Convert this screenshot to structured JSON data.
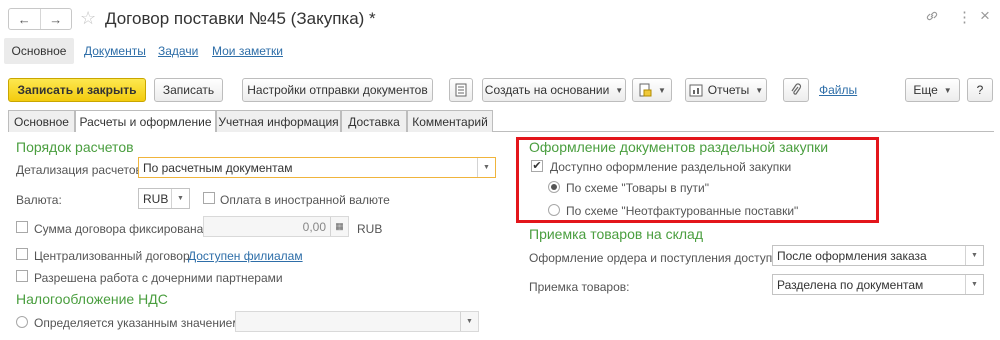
{
  "window": {
    "title": "Договор поставки №45 (Закупка) *",
    "nav_back": "←",
    "nav_forward": "→",
    "star": "☆",
    "link_icon": "🔗",
    "more_icon": "⋮",
    "close_icon": "×"
  },
  "sections": {
    "active": "Основное",
    "links": [
      "Документы",
      "Задачи",
      "Мои заметки"
    ]
  },
  "toolbar": {
    "save_close": "Записать и закрыть",
    "save": "Записать",
    "send_settings": "Настройки отправки документов",
    "create_based": "Создать на основании",
    "reports": "Отчеты",
    "files": "Файлы",
    "more": "Еще",
    "help": "?"
  },
  "tabs": [
    "Основное",
    "Расчеты и оформление",
    "Учетная информация",
    "Доставка",
    "Комментарий"
  ],
  "active_tab": "Расчеты и оформление",
  "left": {
    "settlement_header": "Порядок расчетов",
    "detail_label": "Детализация расчетов:",
    "detail_value": "По расчетным документам",
    "currency_label": "Валюта:",
    "currency_value": "RUB",
    "foreign_payment_label": "Оплата в иностранной валюте",
    "fixed_sum_label": "Сумма договора фиксирована",
    "fixed_sum_value": "0,00",
    "fixed_sum_currency": "RUB",
    "centralized_label": "Централизованный договор",
    "branches_link": "Доступен филиалам",
    "partners_label": "Разрешена работа с дочерними партнерами",
    "vat_header": "Налогообложение НДС",
    "vat_option": "Определяется указанным значением"
  },
  "right": {
    "separate_header": "Оформление документов раздельной закупки",
    "separate_checkbox": "Доступно оформление раздельной закупки",
    "scheme_goods_in_transit": "По схеме \"Товары в пути\"",
    "scheme_uninvoiced": "По схеме \"Неотфактурованные поставки\"",
    "receipt_header": "Приемка товаров на склад",
    "order_label": "Оформление ордера и поступления доступно:",
    "order_value": "После оформления заказа",
    "receipt_label": "Приемка товаров:",
    "receipt_value": "Разделена по документам"
  },
  "colors": {
    "accent_green": "#4a9e3f",
    "primary_yellow": "#f3cb0e",
    "highlight_red": "#e3151b",
    "link_blue": "#2e6ea8"
  }
}
